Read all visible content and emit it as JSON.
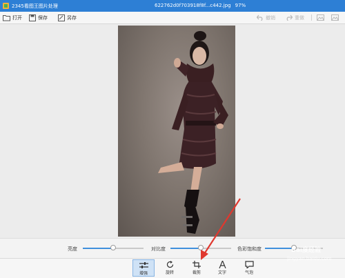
{
  "titlebar": {
    "app_title": "2345看图王图片处理",
    "file_name": "622762d0f703918f8f...c442.jpg",
    "zoom": "97%"
  },
  "toolbar": {
    "open_label": "打开",
    "save_label": "保存",
    "save_as_label": "另存",
    "undo_label": "撤销",
    "redo_label": "重做"
  },
  "adjust": {
    "brightness_label": "亮度",
    "brightness_value": 0.5,
    "contrast_label": "对比度",
    "contrast_value": 0.5,
    "saturation_label": "色彩饱和度",
    "saturation_value": 0.5
  },
  "tools": [
    {
      "label": "增强",
      "icon": "sliders-icon",
      "active": true
    },
    {
      "label": "旋转",
      "icon": "rotate-icon",
      "active": false
    },
    {
      "label": "裁剪",
      "icon": "crop-icon",
      "active": false
    },
    {
      "label": "文字",
      "icon": "text-icon",
      "active": false
    },
    {
      "label": "气泡",
      "icon": "speech-bubble-icon",
      "active": false
    }
  ],
  "watermark": {
    "line1": "Bai度经验",
    "line2": "jingyan.baidu.com"
  },
  "colors": {
    "titlebar": "#2d7fd5",
    "accent": "#3f8fdc",
    "annotation_arrow": "#e0382f"
  }
}
